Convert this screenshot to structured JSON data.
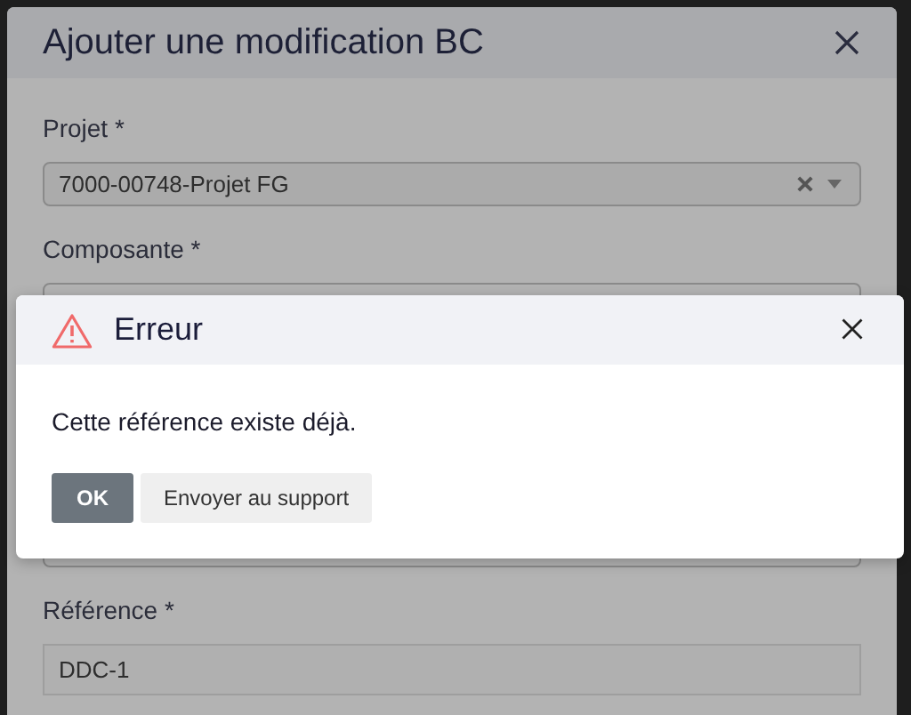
{
  "form_dialog": {
    "title": "Ajouter une modification BC",
    "fields": [
      {
        "label": "Projet *",
        "kind": "select",
        "value": "7000-00748-Projet FG"
      },
      {
        "label": "Composante *",
        "kind": "covered"
      },
      {
        "label": "Référence *",
        "kind": "text",
        "value": "DDC-1"
      }
    ]
  },
  "error_dialog": {
    "title": "Erreur",
    "message": "Cette référence existe déjà.",
    "buttons": [
      {
        "label": "OK",
        "kind": "primary"
      },
      {
        "label": "Envoyer au support",
        "kind": "secondary"
      }
    ]
  }
}
